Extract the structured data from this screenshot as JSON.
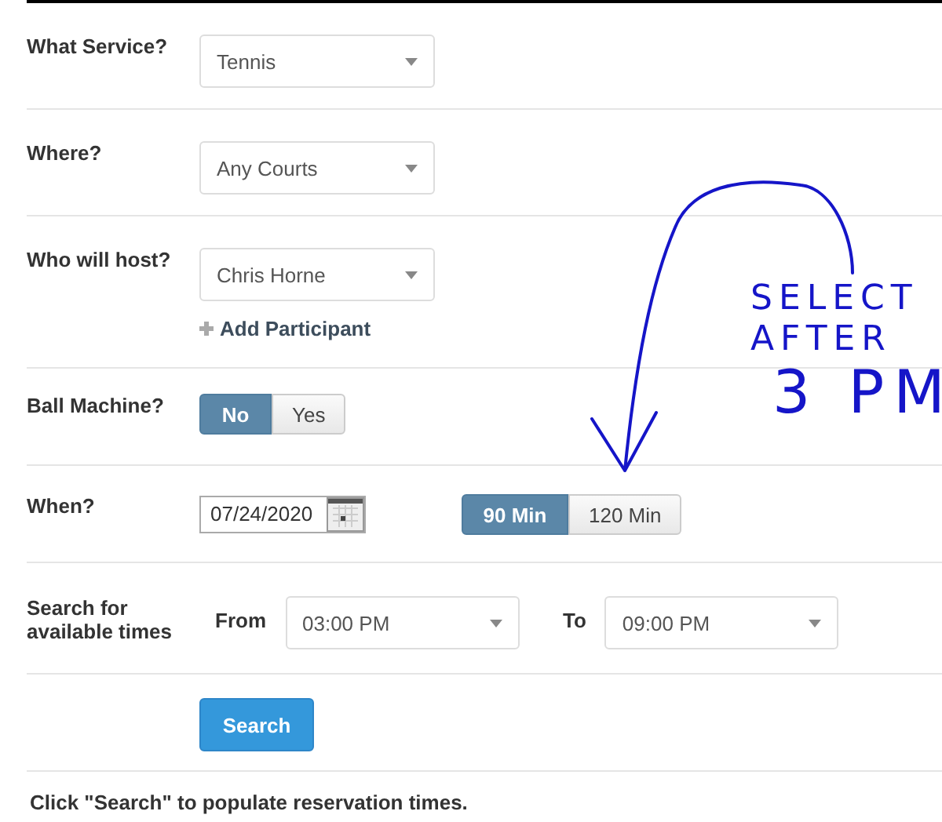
{
  "form": {
    "rows": [
      {
        "kind": "select",
        "label": "What Service?",
        "value": "Tennis"
      },
      {
        "kind": "select",
        "label": "Where?",
        "value": "Any Courts"
      },
      {
        "kind": "select",
        "label": "Who will host?",
        "value": "Chris Horne",
        "link": "Add Participant"
      },
      {
        "kind": "toggle",
        "label": "Ball Machine?",
        "options": [
          {
            "label": "No",
            "selected": true
          },
          {
            "label": "Yes",
            "selected": false
          }
        ]
      },
      {
        "kind": "date",
        "label": "When?",
        "value": "07/24/2020",
        "options": [
          {
            "label": "90 Min",
            "selected": true
          },
          {
            "label": "120 Min",
            "selected": false
          }
        ]
      },
      {
        "kind": "time_range",
        "label": "Search for available times",
        "from_label": "From",
        "from_value": "03:00 PM",
        "to_label": "To",
        "to_value": "09:00 PM"
      },
      {
        "kind": "button",
        "label": "Search"
      }
    ]
  },
  "note": "Click \"Search\" to populate reservation times.",
  "annotation": {
    "lines": [
      "SELECT",
      "AFTER",
      "3 PM"
    ]
  }
}
